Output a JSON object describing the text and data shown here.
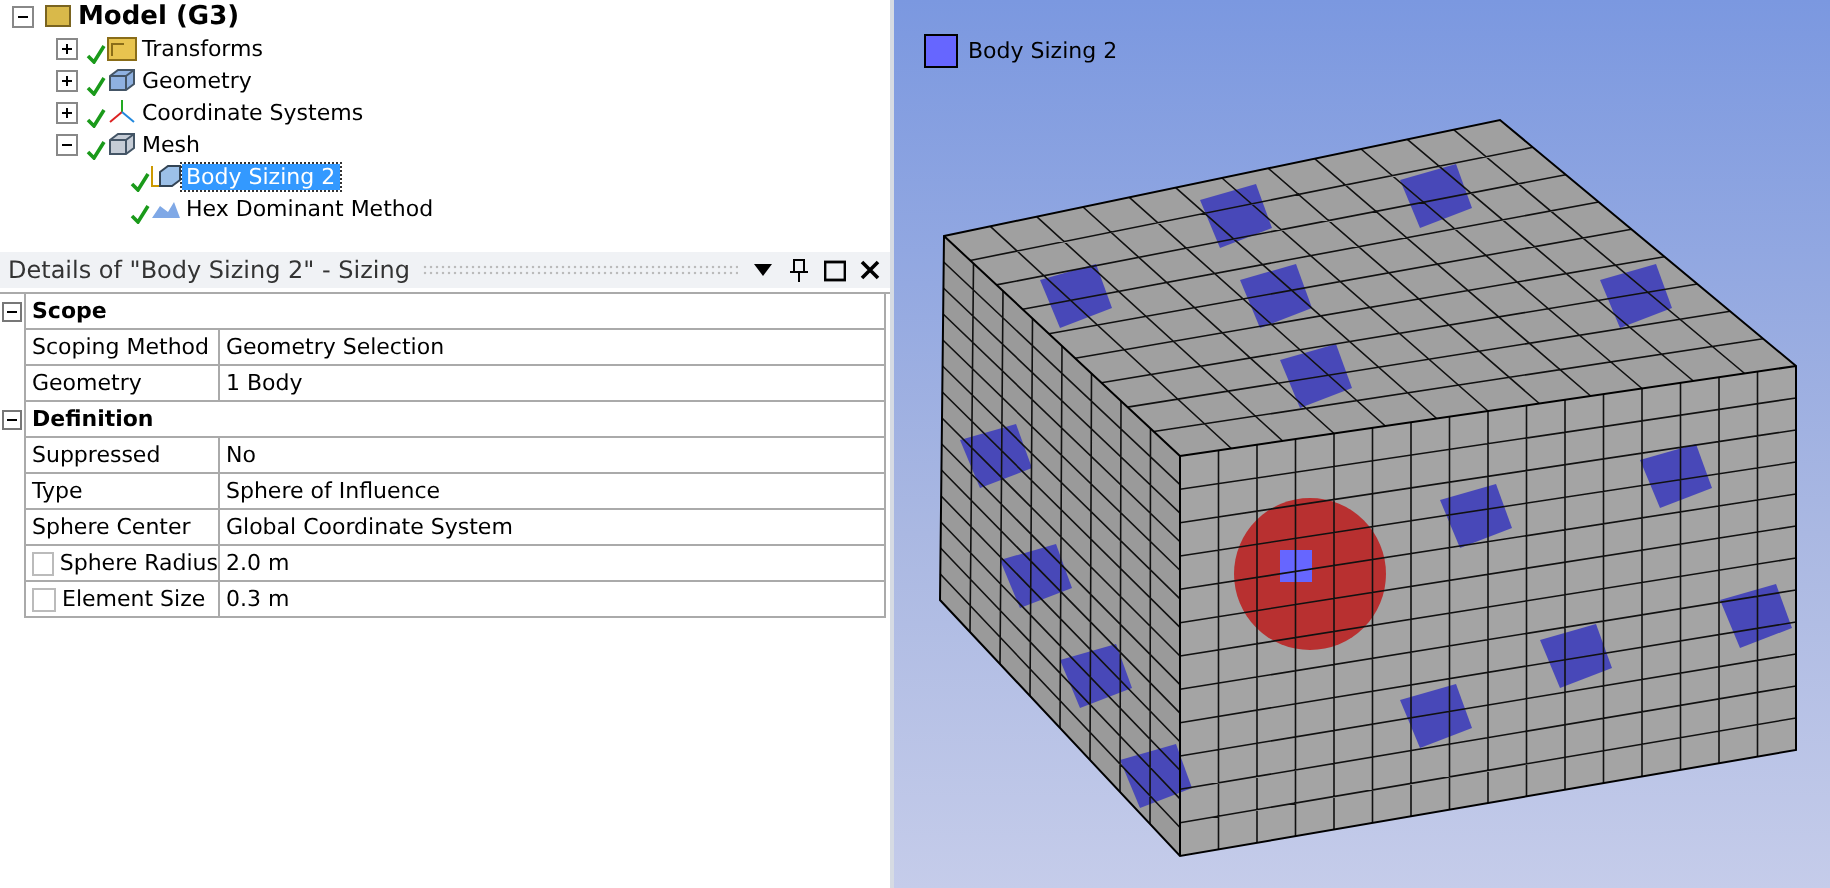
{
  "tree": {
    "label": "Model (G3)",
    "kind": "model",
    "expanded": true,
    "selected": false,
    "children": [
      {
        "label": "Transforms",
        "kind": "folder",
        "expanded": false,
        "selected": false
      },
      {
        "label": "Geometry",
        "kind": "geometry",
        "expanded": false,
        "selected": false
      },
      {
        "label": "Coordinate Systems",
        "kind": "coordinates",
        "expanded": false,
        "selected": false
      },
      {
        "label": "Mesh",
        "kind": "mesh",
        "expanded": true,
        "selected": false,
        "children": [
          {
            "label": "Body Sizing 2",
            "kind": "sizing",
            "selected": true
          },
          {
            "label": "Hex Dominant Method",
            "kind": "method",
            "selected": false
          }
        ]
      }
    ]
  },
  "details": {
    "title": "Details of \"Body Sizing 2\" - Sizing",
    "sections": [
      {
        "label": "Scope",
        "expanded": true,
        "rows": [
          {
            "kind": "plain",
            "label": "Scoping Method",
            "value": "Geometry Selection"
          },
          {
            "kind": "plain",
            "label": "Geometry",
            "value": "1 Body"
          }
        ]
      },
      {
        "label": "Definition",
        "expanded": true,
        "rows": [
          {
            "kind": "plain",
            "label": "Suppressed",
            "value": "No"
          },
          {
            "kind": "plain",
            "label": "Type",
            "value": "Sphere of Influence"
          },
          {
            "kind": "plain",
            "label": "Sphere Center",
            "value": "Global Coordinate System"
          },
          {
            "kind": "checkbox",
            "checked": false,
            "label": "Sphere Radius",
            "value": "2.0 m"
          },
          {
            "kind": "checkbox",
            "checked": false,
            "label": "Element Size",
            "value": "0.3 m"
          }
        ]
      }
    ]
  },
  "viewport": {
    "legend": [
      {
        "label": "Body Sizing 2",
        "color": "#6666ff"
      }
    ]
  }
}
